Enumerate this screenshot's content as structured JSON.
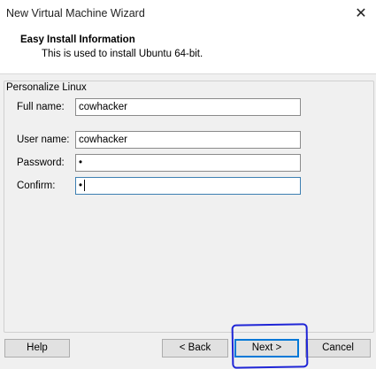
{
  "window": {
    "title": "New Virtual Machine Wizard",
    "close_icon": "close-icon"
  },
  "header": {
    "title": "Easy Install Information",
    "subtitle": "This is used to install Ubuntu 64-bit."
  },
  "group": {
    "label": "Personalize Linux",
    "fields": {
      "full_name": {
        "label": "Full name:",
        "value": "cowhacker"
      },
      "user_name": {
        "label": "User name:",
        "value": "cowhacker"
      },
      "password": {
        "label": "Password:",
        "value": "•"
      },
      "confirm": {
        "label": "Confirm:",
        "value": "•"
      }
    }
  },
  "buttons": {
    "help": "Help",
    "back": "< Back",
    "next": "Next >",
    "cancel": "Cancel"
  },
  "colors": {
    "annotation": "#1f25d6",
    "focus_border": "#3c7fb1"
  }
}
